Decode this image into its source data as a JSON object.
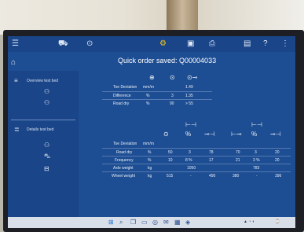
{
  "header": {
    "title": "Quick order saved: Q00004033"
  },
  "sidebar": {
    "section1_label": "Overview test bed",
    "section2_label": "Details test bed"
  },
  "table1": {
    "header_label": "Toe Deviation",
    "header_unit": "mm/m",
    "header_value": "1.49",
    "rows": [
      {
        "label": "Difference",
        "unit": "%",
        "v1": "3",
        "v2": "1.35"
      },
      {
        "label": "Road dry",
        "unit": "%",
        "v1": "90",
        "v2": "> 55"
      }
    ]
  },
  "table2": {
    "header_label": "Toe Deviation",
    "header_unit": "mm/m",
    "rows": [
      {
        "label": "Road dry",
        "unit": "%",
        "values": [
          "50",
          "3",
          "78",
          "70",
          "3",
          "20"
        ]
      },
      {
        "label": "Frequency",
        "unit": "%",
        "values": [
          "10",
          "8 %",
          "17",
          "21",
          "3 %",
          "20"
        ]
      },
      {
        "label": "Axle weight",
        "unit": "kg",
        "values": [
          "",
          "1050",
          "",
          "",
          "783",
          ""
        ]
      },
      {
        "label": "Wheel weight",
        "unit": "kg",
        "values": [
          "515",
          "-",
          "490",
          "380",
          "-",
          "396"
        ]
      }
    ]
  },
  "colors": {
    "screen_bg": "#1d4d92",
    "sidebar_bg": "#1a4588",
    "accent_icon": "#f0c419"
  }
}
